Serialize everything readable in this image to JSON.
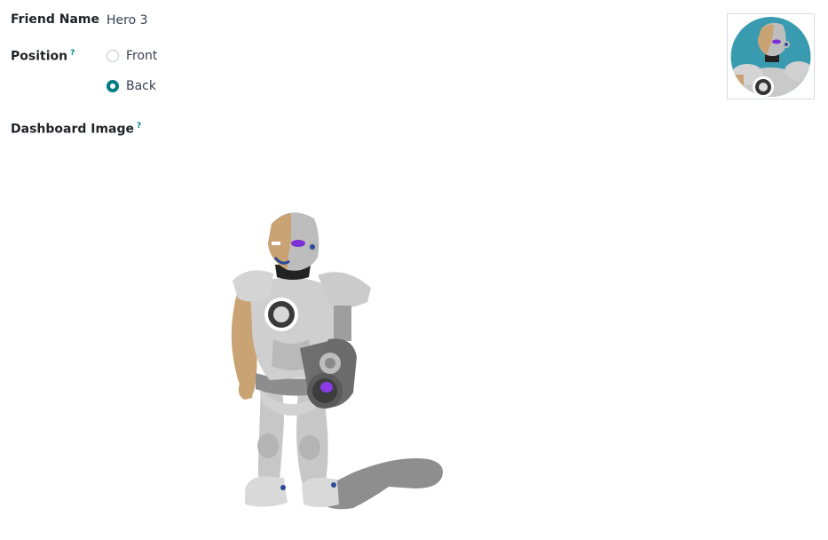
{
  "form": {
    "friend_name_label": "Friend Name",
    "friend_name_value": "Hero 3",
    "position_label": "Position",
    "position_help": "?",
    "position_options": [
      {
        "label": "Front",
        "checked": false
      },
      {
        "label": "Back",
        "checked": true
      }
    ],
    "dashboard_image_label": "Dashboard Image",
    "dashboard_image_help": "?"
  },
  "images": {
    "avatar": "robot-hero-avatar",
    "dashboard": "robot-hero-full-body"
  },
  "colors": {
    "accent": "#017e84",
    "avatar_bg": "#3a9bb0"
  }
}
